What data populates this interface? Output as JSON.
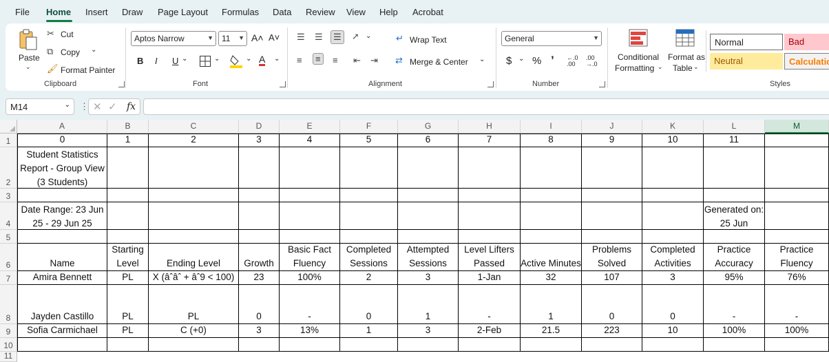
{
  "menu": {
    "tabs": [
      "File",
      "Home",
      "Insert",
      "Draw",
      "Page Layout",
      "Formulas",
      "Data",
      "Review",
      "View",
      "Help",
      "Acrobat"
    ],
    "active": "Home"
  },
  "ribbon": {
    "clipboard": {
      "paste": "Paste",
      "cut": "Cut",
      "copy": "Copy",
      "format_painter": "Format Painter",
      "label": "Clipboard"
    },
    "font": {
      "font_name": "Aptos Narrow",
      "font_size": "11",
      "grow": "A˄",
      "shrink": "A˅",
      "bold": "B",
      "italic": "I",
      "underline": "U",
      "font_color_glyph": "A",
      "label": "Font",
      "accent_color": "#d13438",
      "fill_color": "#ffd400"
    },
    "alignment": {
      "wrap_text": "Wrap Text",
      "merge_center": "Merge & Center",
      "label": "Alignment"
    },
    "number": {
      "format": "General",
      "currency": "$",
      "percent": "%",
      "comma": "’",
      "inc_dec": "←.0 .00",
      "dec_dec": ".00 →.0",
      "label": "Number"
    },
    "styles": {
      "conditional": "Conditional",
      "conditional2": "Formatting",
      "format_as": "Format as",
      "format_as2": "Table",
      "normal": "Normal",
      "bad": "Bad",
      "neutral": "Neutral",
      "calculation": "Calculatio",
      "label": "Styles"
    }
  },
  "formula_bar": {
    "name_box": "M14",
    "fx": "fx",
    "formula": ""
  },
  "grid": {
    "columns": [
      "A",
      "B",
      "C",
      "D",
      "E",
      "F",
      "G",
      "H",
      "I",
      "J",
      "K",
      "L",
      "M"
    ],
    "selected_column": "M",
    "rows": [
      "1",
      "2",
      "3",
      "4",
      "5",
      "6",
      "7",
      "8",
      "9",
      "10",
      "11"
    ],
    "cells": {
      "r1": [
        "0",
        "1",
        "2",
        "3",
        "4",
        "5",
        "6",
        "7",
        "8",
        "9",
        "10",
        "11",
        ""
      ],
      "r2": [
        "Student Statistics Report - Group View (3 Students)",
        "",
        "",
        "",
        "",
        "",
        "",
        "",
        "",
        "",
        "",
        "",
        ""
      ],
      "r3": [
        "",
        "",
        "",
        "",
        "",
        "",
        "",
        "",
        "",
        "",
        "",
        "",
        ""
      ],
      "r4": [
        "Date Range: 23 Jun 25 - 29 Jun 25",
        "",
        "",
        "",
        "",
        "",
        "",
        "",
        "",
        "",
        "",
        "Generated on: 25 Jun",
        ""
      ],
      "r5": [
        "",
        "",
        "",
        "",
        "",
        "",
        "",
        "",
        "",
        "",
        "",
        "",
        ""
      ],
      "r6": [
        "Name",
        "Starting Level",
        "Ending Level",
        "Growth",
        "Basic Fact Fluency",
        "Completed Sessions",
        "Attempted Sessions",
        "Level Lifters Passed",
        "Active Minutes",
        "Problems Solved",
        "Completed Activities",
        "Practice Accuracy",
        "Practice Fluency"
      ],
      "r7": [
        "Amira Bennett",
        "PL",
        "X (âˆâˆ + âˆ9 < 100)",
        "23",
        "100%",
        "2",
        "3",
        "1-Jan",
        "32",
        "107",
        "3",
        "95%",
        "76%"
      ],
      "r8": [
        "Jayden Castillo",
        "PL",
        "PL",
        "0",
        "-",
        "0",
        "1",
        "-",
        "1",
        "0",
        "0",
        "-",
        "-"
      ],
      "r9": [
        "Sofia Carmichael",
        "PL",
        "C (+0)",
        "3",
        "13%",
        "1",
        "3",
        "2-Feb",
        "21.5",
        "223",
        "10",
        "100%",
        "100%"
      ],
      "r10": [
        "",
        "",
        "",
        "",
        "",
        "",
        "",
        "",
        "",
        "",
        "",
        "",
        ""
      ]
    }
  },
  "colors": {
    "accent": "#107c41",
    "ribbon_bg": "#e8f1f4",
    "bad_bg": "#ffc7ce",
    "bad_text": "#9c0006",
    "neutral_bg": "#ffeb9c",
    "neutral_text": "#9c5700",
    "calc_text": "#fa7d00"
  }
}
